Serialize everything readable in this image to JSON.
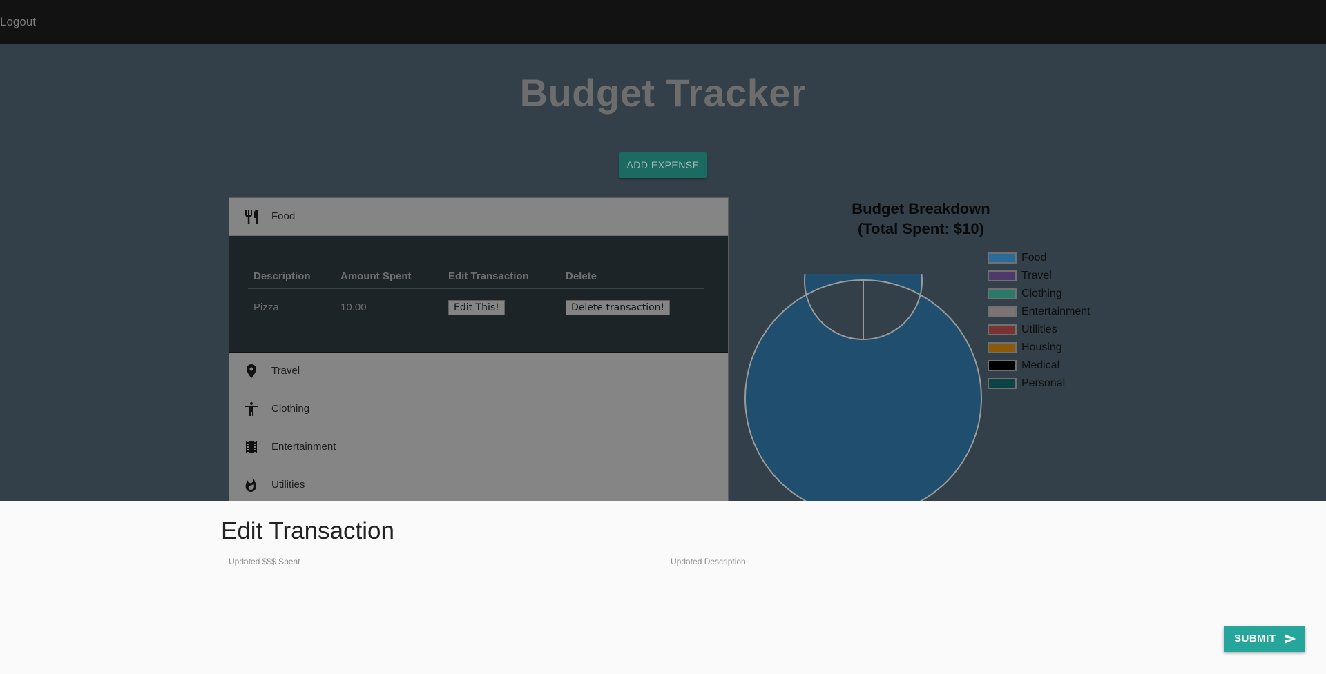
{
  "nav": {
    "logout": "Logout"
  },
  "page": {
    "title": "Budget Tracker",
    "add_expense": "ADD EXPENSE"
  },
  "categories": [
    {
      "label": "Food",
      "icon": "fork-knife-icon"
    },
    {
      "label": "Travel",
      "icon": "location-pin-icon"
    },
    {
      "label": "Clothing",
      "icon": "person-icon"
    },
    {
      "label": "Entertainment",
      "icon": "film-icon"
    },
    {
      "label": "Utilities",
      "icon": "flame-icon"
    }
  ],
  "table": {
    "headers": [
      "Description",
      "Amount Spent",
      "Edit Transaction",
      "Delete"
    ],
    "rows": [
      {
        "description": "Pizza",
        "amount": "10.00",
        "edit": "Edit This!",
        "delete": "Delete transaction!"
      }
    ]
  },
  "chart_data": {
    "type": "pie",
    "title_line1": "Budget Breakdown",
    "title_line2": "(Total Spent: $10)",
    "series": [
      {
        "name": "Food",
        "value": 10,
        "color": "#1f4e6e",
        "legend_color": "#2b6b99"
      },
      {
        "name": "Travel",
        "value": 0,
        "color": "#4a3a66",
        "legend_color": "#4d3a6a"
      },
      {
        "name": "Clothing",
        "value": 0,
        "color": "#2b7a67",
        "legend_color": "#2b7a67"
      },
      {
        "name": "Entertainment",
        "value": 0,
        "color": "#7d7373",
        "legend_color": "#7d7373"
      },
      {
        "name": "Utilities",
        "value": 0,
        "color": "#7a3232",
        "legend_color": "#7a3232"
      },
      {
        "name": "Housing",
        "value": 0,
        "color": "#8a5a0a",
        "legend_color": "#8a5a0a"
      },
      {
        "name": "Medical",
        "value": 0,
        "color": "#000000",
        "legend_color": "#000000"
      },
      {
        "name": "Personal",
        "value": 0,
        "color": "#0a4444",
        "legend_color": "#0a4444"
      }
    ],
    "legend_position": "right",
    "donut": true
  },
  "modal": {
    "title": "Edit Transaction",
    "amount_label": "Updated $$$ Spent",
    "amount_value": "",
    "description_label": "Updated Description",
    "description_value": "",
    "submit": "SUBMIT",
    "submit_icon": "send-icon"
  }
}
